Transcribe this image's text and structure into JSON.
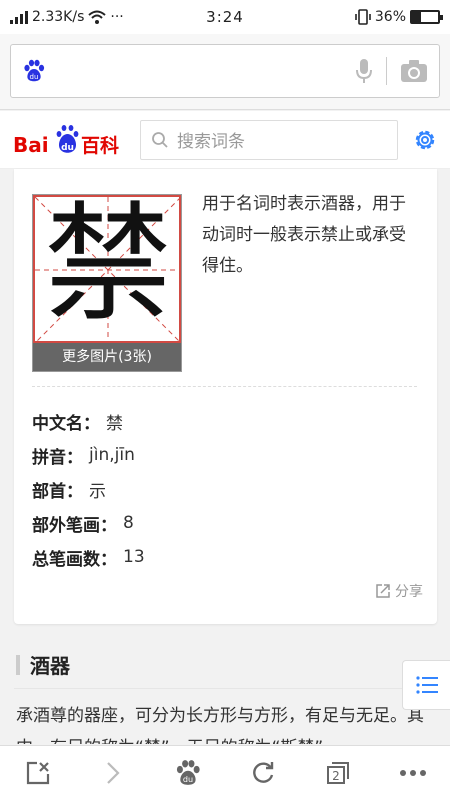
{
  "status_bar": {
    "speed": "2.33K/s",
    "dots": "···",
    "time": "3:24",
    "battery_pct": "36%",
    "battery_level": 0.36
  },
  "search_header": {
    "placeholder": "搜索词条"
  },
  "char_card": {
    "character": "禁",
    "more_images": "更多图片(3张)",
    "description": "用于名词时表示酒器，用于动词时一般表示禁止或承受得住。",
    "info": [
      {
        "label": "中文名：",
        "value": "禁"
      },
      {
        "label": "拼音：",
        "value": "jìn,jīn"
      },
      {
        "label": "部首：",
        "value": "示"
      },
      {
        "label": "部外笔画：",
        "value": "8"
      },
      {
        "label": "总笔画数：",
        "value": "13"
      }
    ],
    "share": "分享"
  },
  "section": {
    "title": "酒器",
    "text": "承酒尊的器座，可分为长方形与方形，有足与无足。其中，有足的称为“禁”，无足的称为“斯禁”。"
  },
  "colors": {
    "baidu_red": "#e10601",
    "baidu_blue": "#2932e1",
    "grid_red": "#d24a43",
    "gear_blue": "#3385ff"
  }
}
